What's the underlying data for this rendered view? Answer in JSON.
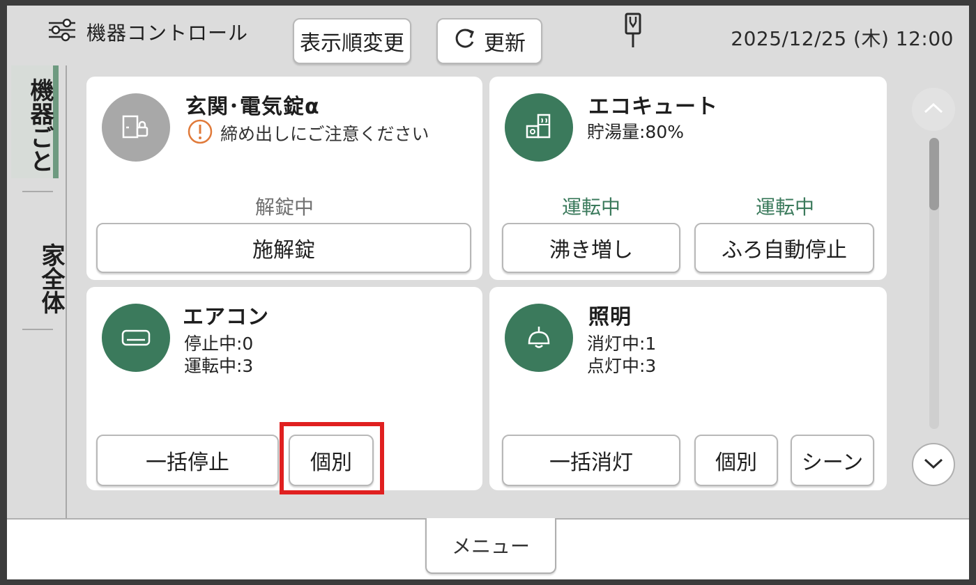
{
  "header": {
    "title": "機器コントロール",
    "title_icon": "sliders-icon",
    "reorder_label": "表示順変更",
    "refresh_label": "更新",
    "refresh_icon": "refresh-icon",
    "status_icon": "plug-icon",
    "datetime": "2025/12/25 (木) 12:00"
  },
  "side_tabs": [
    {
      "label": "機器ごと",
      "active": true
    },
    {
      "label": "家全体",
      "active": false
    }
  ],
  "cards": {
    "entrance": {
      "name": "玄関･電気錠α",
      "icon": "door-lock-icon",
      "warning_icon": "exclamation-circle-icon",
      "warning": "締め出しにご注意ください",
      "status": "解錠中",
      "button": "施解錠"
    },
    "ecocute": {
      "name": "エコキュート",
      "icon": "water-heater-icon",
      "line1": "貯湯量:80%",
      "status1": "運転中",
      "status2": "運転中",
      "button1": "沸き増し",
      "button2": "ふろ自動停止"
    },
    "aircon": {
      "name": "エアコン",
      "icon": "air-conditioner-icon",
      "line1": "停止中:0",
      "line2": "運転中:3",
      "button1": "一括停止",
      "button2": "個別"
    },
    "lighting": {
      "name": "照明",
      "icon": "pendant-lamp-icon",
      "line1": "消灯中:1",
      "line2": "点灯中:3",
      "button1": "一括消灯",
      "button2": "個別",
      "button3": "シーン"
    }
  },
  "scroll": {
    "position": 0.0
  },
  "footer": {
    "menu_label": "メニュー"
  },
  "colors": {
    "accent_green": "#3b7a5c",
    "highlight_red": "#e02020"
  }
}
